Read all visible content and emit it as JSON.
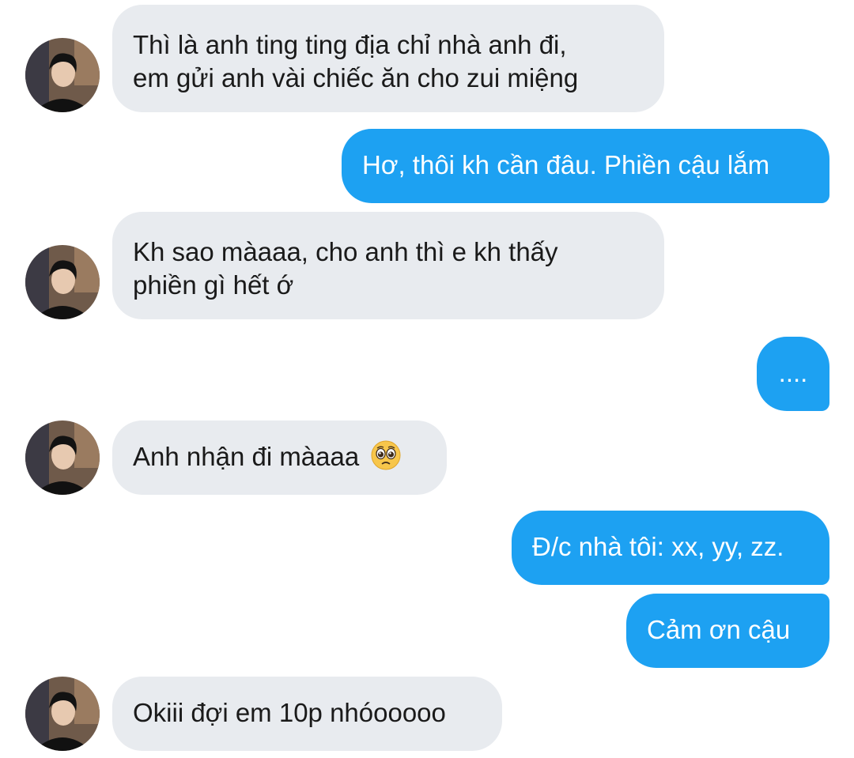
{
  "conversation": {
    "messages": [
      {
        "direction": "incoming",
        "lines": [
          "Thì là anh ting ting địa chỉ nhà anh đi,",
          "em gửi anh vài chiếc ăn cho zui miệng"
        ]
      },
      {
        "direction": "outgoing",
        "text": "Hơ, thôi kh cần đâu. Phiền cậu lắm"
      },
      {
        "direction": "incoming",
        "lines": [
          "Kh sao màaaa, cho anh thì e kh thấy",
          "phiền gì hết ớ"
        ]
      },
      {
        "direction": "outgoing",
        "text": "...."
      },
      {
        "direction": "incoming",
        "text": "Anh nhận đi màaaa",
        "emoji": "pleading-face-emoji"
      },
      {
        "direction": "outgoing",
        "text": "Đ/c nhà tôi: xx, yy, zz."
      },
      {
        "direction": "outgoing",
        "text": "Cảm ơn cậu"
      },
      {
        "direction": "incoming",
        "text": "Okiii đợi em 10p nhóooooo"
      }
    ]
  },
  "colors": {
    "incoming_bubble": "#e8ebef",
    "outgoing_bubble": "#1da1f2",
    "incoming_text": "#1a1a1a",
    "outgoing_text": "#ffffff"
  },
  "icons": {
    "avatar": "contact-avatar-photo"
  }
}
